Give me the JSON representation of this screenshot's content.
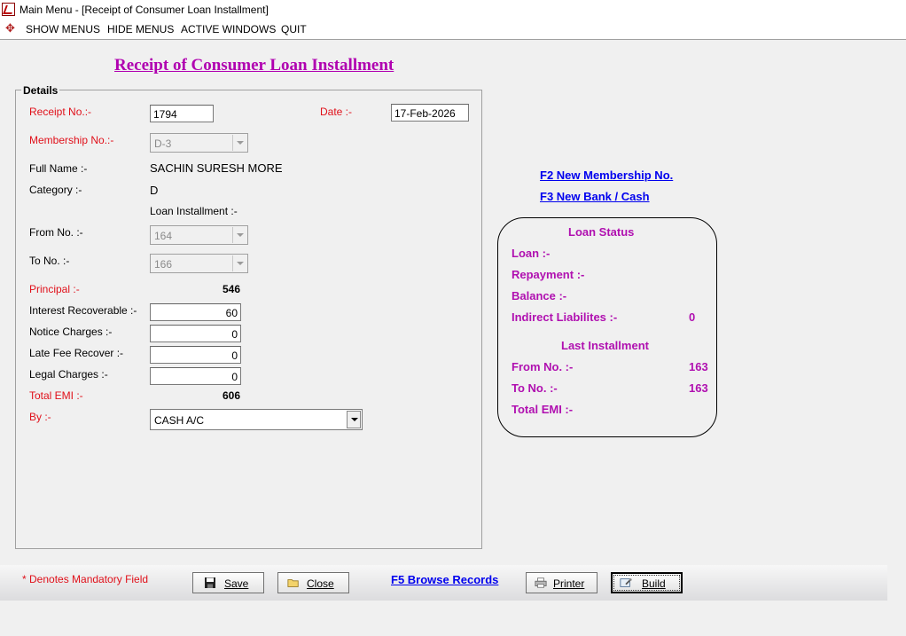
{
  "window": {
    "title": "Main Menu - [Receipt of Consumer Loan Installment]"
  },
  "menu": {
    "items": [
      "SHOW MENUS",
      "HIDE MENUS",
      "ACTIVE WINDOWS",
      "QUIT"
    ]
  },
  "form": {
    "title": "Receipt of Consumer Loan Installment",
    "group_label": "Details",
    "labels": {
      "receipt_no": "Receipt No.:-",
      "date": "Date :-",
      "membership_no": "Membership No.:-",
      "full_name": "Full Name :-",
      "category": "Category :-",
      "loan_installment": "Loan Installment :-",
      "from_no": "From No. :-",
      "to_no": "To No. :-",
      "principal": "Principal :-",
      "interest_recoverable": "Interest Recoverable :-",
      "notice_charges": "Notice Charges :-",
      "late_fee_recover": "Late Fee Recover :-",
      "legal_charges": "Legal Charges :-",
      "total_emi": "Total EMI :-",
      "by": "By :-"
    },
    "values": {
      "receipt_no": "1794",
      "date": "17-Feb-2026",
      "membership_no": "D-3",
      "full_name": "SACHIN SURESH MORE",
      "category": "D",
      "from_no": "164",
      "to_no": "166",
      "principal": "546",
      "interest_recoverable": "60",
      "notice_charges": "0",
      "late_fee_recover": "0",
      "legal_charges": "0",
      "total_emi": "606",
      "by": "CASH A/C"
    }
  },
  "shortcuts": {
    "new_membership": "F2 New Membership No.",
    "new_bank_cash": "F3 New Bank / Cash",
    "browse_records": "F5 Browse Records"
  },
  "loan_status": {
    "title": "Loan Status",
    "loan_label": "Loan :-",
    "repayment_label": "Repayment :-",
    "balance_label": "Balance :-",
    "indirect_label": "Indirect Liabilites :-",
    "indirect_value": "0",
    "last_installment_title": "Last Installment",
    "from_label": "From No. :-",
    "from_value": "163",
    "to_label": "To No. :-",
    "to_value": "163",
    "total_emi_label": "Total EMI :-"
  },
  "footer": {
    "mandatory_note": "* Denotes Mandatory Field",
    "save": "Save",
    "close": "Close",
    "printer": "Printer",
    "build": "Build"
  },
  "colors": {
    "mandatory_red": "#e0101a",
    "title_magenta": "#b000b0",
    "link_blue": "#0000ee"
  }
}
